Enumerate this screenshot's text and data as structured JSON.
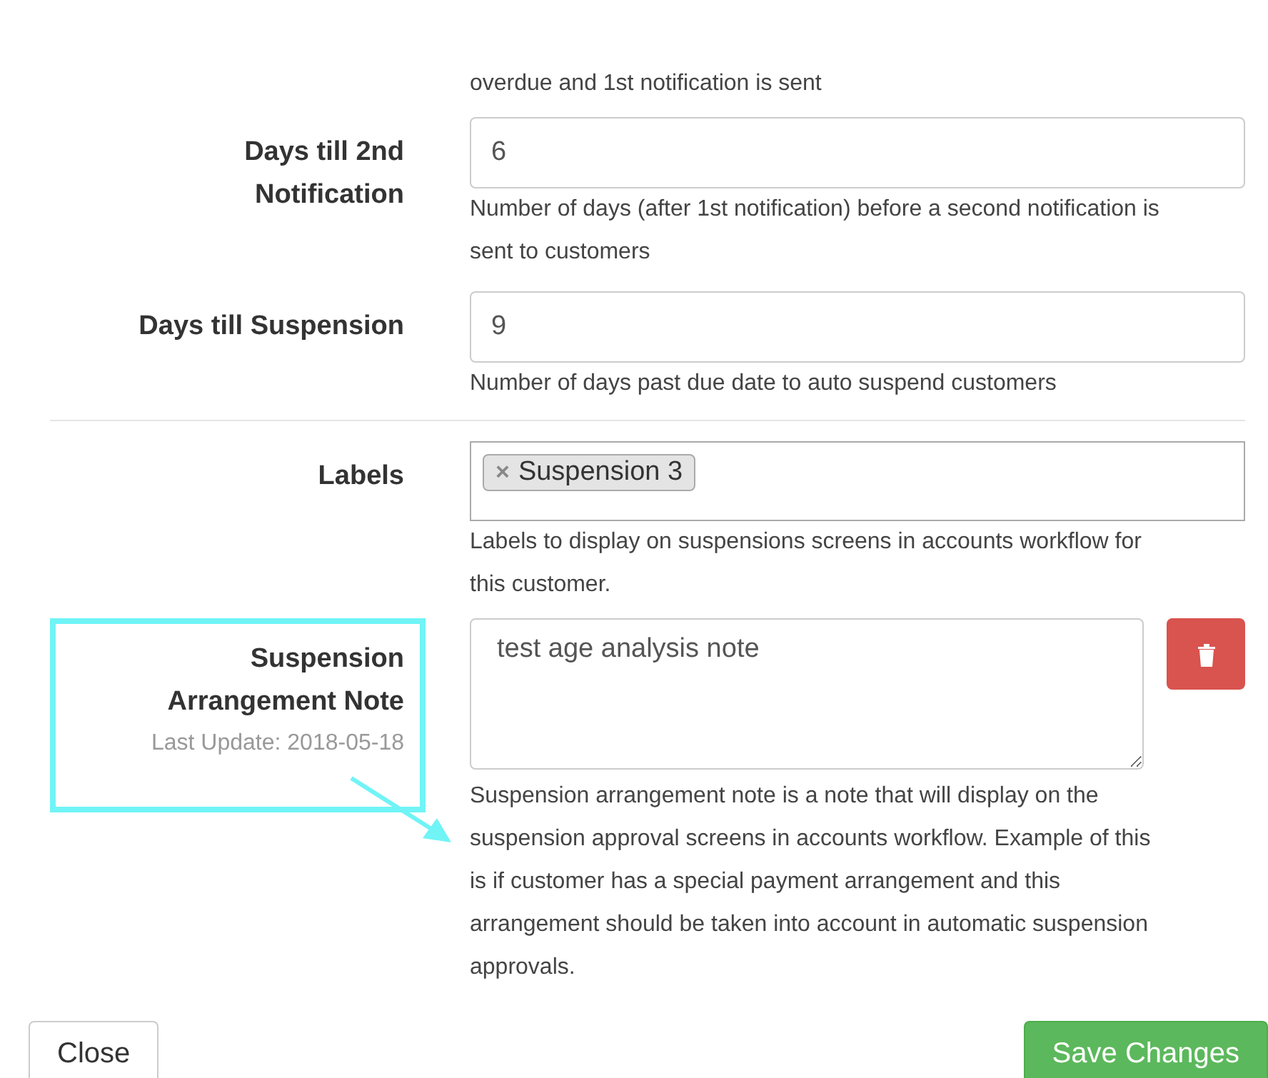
{
  "top_help": "overdue and 1st notification is sent",
  "fields": [
    {
      "kind": "input",
      "label": "Days till 2nd Notification",
      "value": "6",
      "help": "Number of days (after 1st notification) before a second notification is sent to customers"
    },
    {
      "kind": "input",
      "label": "Days till Suspension",
      "value": "9",
      "help": "Number of days past due date to auto suspend customers"
    },
    {
      "kind": "tags",
      "label": "Labels",
      "tags": [
        {
          "remove": "×",
          "text": "Suspension 3"
        }
      ],
      "help": "Labels to display on suspensions screens in accounts workflow for this customer."
    },
    {
      "kind": "note",
      "label": "Suspension Arrangement Note",
      "sublabel": "Last Update: 2018-05-18",
      "value": "test age analysis note",
      "highlighted": true,
      "help": "Suspension arrangement note is a note that will display on the suspension approval screens in accounts workflow. Example of this is if customer has a special payment arrangement and this arrangement should be taken into account in automatic suspension approvals."
    }
  ],
  "buttons": [
    {
      "kind": "default",
      "label": "Close"
    },
    {
      "kind": "primary",
      "label": "Save Changes"
    }
  ]
}
